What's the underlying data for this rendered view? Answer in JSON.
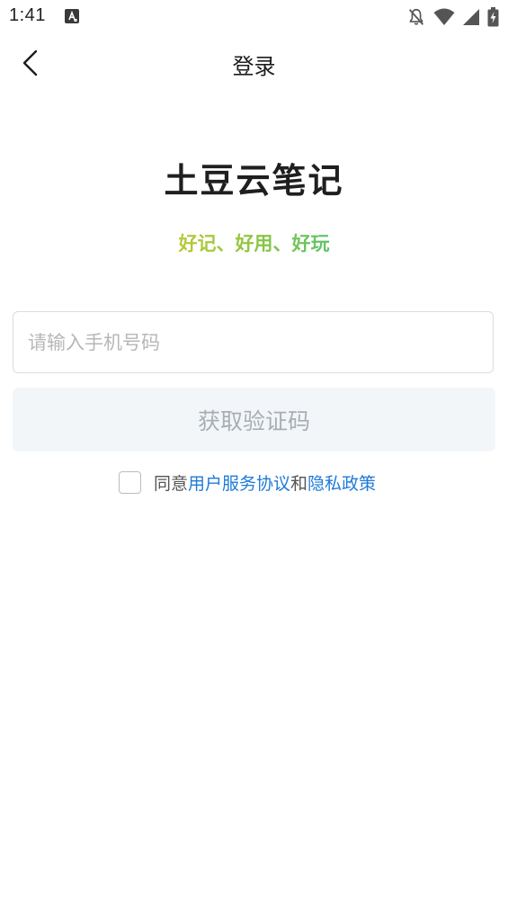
{
  "status_bar": {
    "time": "1:41",
    "icons": [
      "a-notification-icon",
      "bell-off-icon",
      "wifi-icon",
      "signal-icon",
      "battery-charging-icon"
    ]
  },
  "nav": {
    "title": "登录",
    "back_icon": "chevron-left-icon"
  },
  "brand": {
    "app_name": "土豆云笔记",
    "slogan": "好记、好用、好玩",
    "slogan_gradient": [
      "#b9c93a",
      "#5cc46a"
    ]
  },
  "form": {
    "phone_placeholder": "请输入手机号码",
    "phone_value": "",
    "get_code_label": "获取验证码"
  },
  "agreement": {
    "checked": false,
    "prefix": "同意",
    "terms_link": "用户服务协议",
    "conjunction": "和",
    "privacy_link": "隐私政策",
    "link_color": "#1f7ad8"
  }
}
